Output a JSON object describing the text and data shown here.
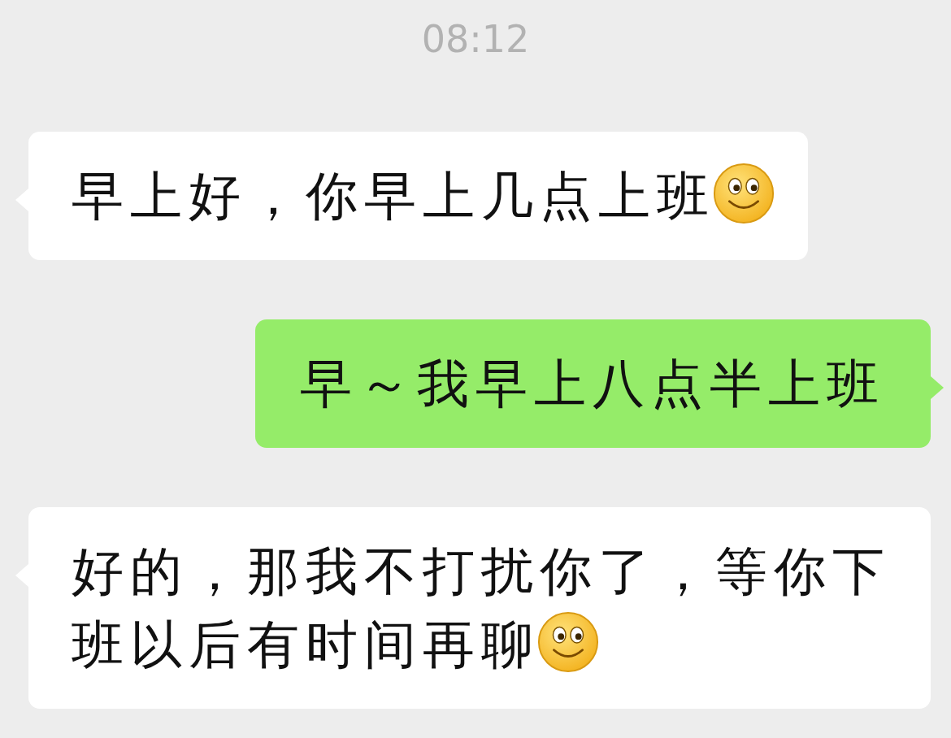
{
  "timestamp": "08:12",
  "messages": [
    {
      "kind": "received",
      "text": "早上好，你早上几点上班",
      "emoji": true
    },
    {
      "kind": "sent",
      "text": "早～我早上八点半上班",
      "emoji": false
    },
    {
      "kind": "received",
      "text": "好的，那我不打扰你了，等你下班以后有时间再聊",
      "emoji": true
    }
  ]
}
